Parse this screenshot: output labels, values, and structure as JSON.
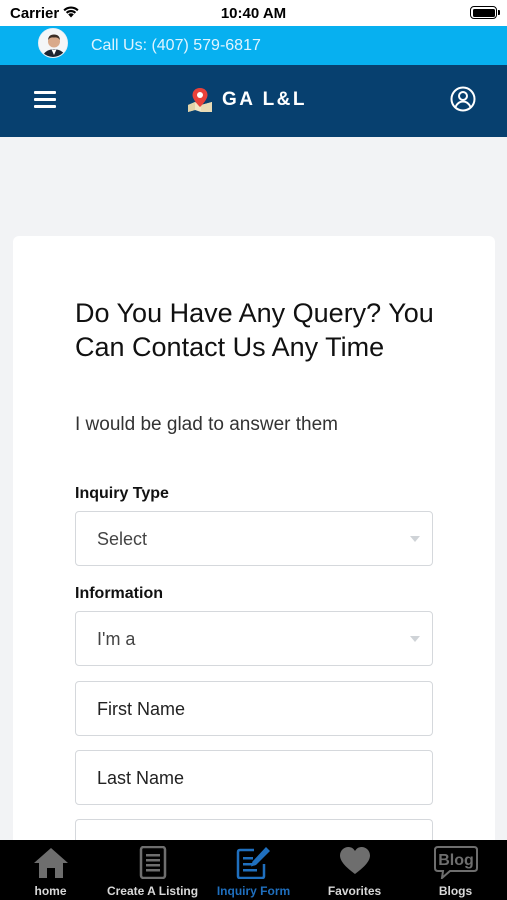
{
  "status_bar": {
    "carrier": "Carrier",
    "time": "10:40 AM"
  },
  "call_bar": {
    "text": "Call Us: (407) 579-6817"
  },
  "header": {
    "logo_text": "GA L&L"
  },
  "form": {
    "title": "Do You Have Any Query? You Can Contact Us Any Time",
    "subtitle": "I would be glad to answer them",
    "inquiry_type": {
      "label": "Inquiry Type",
      "value": "Select"
    },
    "information": {
      "label": "Information",
      "value": "I'm a"
    },
    "first_name": {
      "placeholder": "First Name"
    },
    "last_name": {
      "placeholder": "Last Name"
    }
  },
  "tabs": [
    {
      "label": "home",
      "icon": "home-icon"
    },
    {
      "label": "Create A Listing",
      "icon": "document-icon"
    },
    {
      "label": "Inquiry Form",
      "icon": "edit-form-icon",
      "active": true
    },
    {
      "label": "Favorites",
      "icon": "heart-icon"
    },
    {
      "label": "Blogs",
      "icon": "blog-icon"
    }
  ],
  "colors": {
    "call_bar": "#07b0f0",
    "header": "#07406f",
    "active_tab": "#1f6fbe",
    "tab_bar": "#000000",
    "logo_pin": "#e8413a"
  }
}
